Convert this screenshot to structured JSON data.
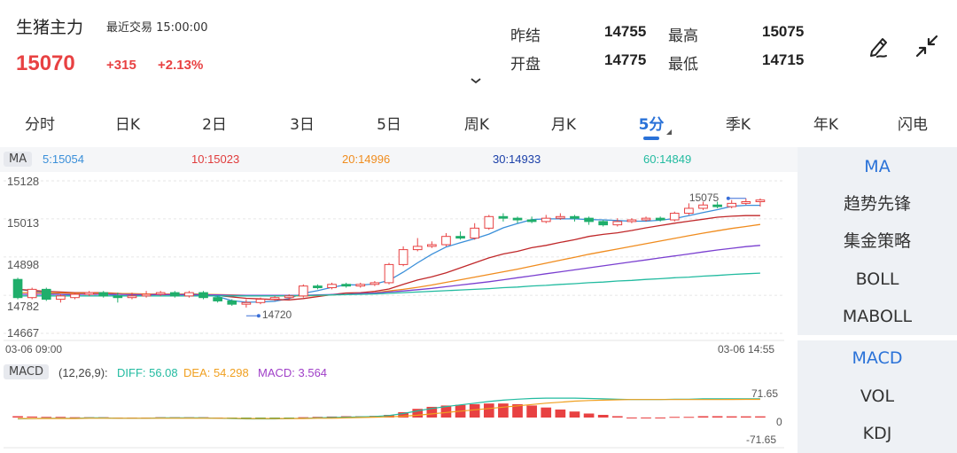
{
  "header": {
    "name": "生猪主力",
    "trade_time": "最近交易 15:00:00",
    "price": "15070",
    "change": "+315",
    "change_pct": "+2.13%",
    "quotes": [
      {
        "label": "昨结",
        "value": "14755"
      },
      {
        "label": "最高",
        "value": "15075"
      },
      {
        "label": "开盘",
        "value": "14775"
      },
      {
        "label": "最低",
        "value": "14715"
      }
    ]
  },
  "tabs": [
    "分时",
    "日K",
    "2日",
    "3日",
    "5日",
    "周K",
    "月K",
    "5分",
    "季K",
    "年K",
    "闪电"
  ],
  "active_tab": "5分",
  "indicators": {
    "main": [
      "MA",
      "趋势先锋",
      "集金策略",
      "BOLL",
      "MABOLL"
    ],
    "sub": [
      "MACD",
      "VOL",
      "KDJ"
    ],
    "active_main": "MA",
    "active_sub": "MACD"
  },
  "ma_legend": {
    "badge": "MA",
    "items": [
      {
        "label": "5:15054",
        "color": "#3a8fd9"
      },
      {
        "label": "10:15023",
        "color": "#e03c3c"
      },
      {
        "label": "20:14996",
        "color": "#f08c1e"
      },
      {
        "label": "30:14933",
        "color": "#1a3fa8"
      },
      {
        "label": "60:14849",
        "color": "#22bba0"
      }
    ]
  },
  "macd_legend": {
    "badge": "MACD",
    "params": "(12,26,9):",
    "diff": "DIFF: 56.08",
    "dea": "DEA: 54.298",
    "macd": "MACD: 3.564",
    "diff_color": "#22bba0",
    "dea_color": "#f0a020",
    "macd_color": "#a040c8"
  },
  "colors": {
    "up": "#e84142",
    "down": "#1fae6b",
    "accent": "#2a72d8"
  },
  "chart_data": {
    "type": "candlestick",
    "y_ticks": [
      "15128",
      "15013",
      "14898",
      "14782",
      "14667"
    ],
    "y_tick_values": [
      15128,
      15013,
      14898,
      14782,
      14667
    ],
    "ylim": [
      14667,
      15128
    ],
    "x_labels": [
      "03-06 09:00",
      "03-06 14:55"
    ],
    "high_label": "15075",
    "low_label": "14720",
    "high_value": 15075,
    "low_value": 14720,
    "candles": [
      [
        14830,
        14775,
        14835,
        14770
      ],
      [
        14775,
        14800,
        14805,
        14770
      ],
      [
        14800,
        14770,
        14805,
        14765
      ],
      [
        14770,
        14780,
        14785,
        14760
      ],
      [
        14775,
        14785,
        14790,
        14770
      ],
      [
        14785,
        14790,
        14795,
        14780
      ],
      [
        14790,
        14780,
        14795,
        14775
      ],
      [
        14780,
        14775,
        14790,
        14760
      ],
      [
        14775,
        14780,
        14790,
        14770
      ],
      [
        14780,
        14785,
        14795,
        14775
      ],
      [
        14785,
        14790,
        14795,
        14780
      ],
      [
        14790,
        14780,
        14795,
        14775
      ],
      [
        14780,
        14790,
        14795,
        14775
      ],
      [
        14790,
        14775,
        14795,
        14770
      ],
      [
        14775,
        14765,
        14780,
        14760
      ],
      [
        14765,
        14755,
        14770,
        14750
      ],
      [
        14755,
        14760,
        14770,
        14745
      ],
      [
        14760,
        14770,
        14775,
        14755
      ],
      [
        14770,
        14775,
        14780,
        14765
      ],
      [
        14775,
        14780,
        14785,
        14770
      ],
      [
        14780,
        14810,
        14815,
        14775
      ],
      [
        14810,
        14805,
        14815,
        14800
      ],
      [
        14805,
        14815,
        14820,
        14800
      ],
      [
        14815,
        14810,
        14820,
        14805
      ],
      [
        14810,
        14815,
        14820,
        14805
      ],
      [
        14815,
        14820,
        14825,
        14810
      ],
      [
        14820,
        14875,
        14880,
        14815
      ],
      [
        14875,
        14920,
        14930,
        14870
      ],
      [
        14920,
        14930,
        14955,
        14915
      ],
      [
        14930,
        14935,
        14945,
        14925
      ],
      [
        14935,
        14960,
        14970,
        14930
      ],
      [
        14960,
        14955,
        14975,
        14950
      ],
      [
        14955,
        14985,
        15000,
        14950
      ],
      [
        14985,
        15020,
        15025,
        14980
      ],
      [
        15020,
        15015,
        15030,
        15005
      ],
      [
        15015,
        15010,
        15020,
        15000
      ],
      [
        15010,
        15005,
        15020,
        15000
      ],
      [
        15005,
        15015,
        15025,
        15000
      ],
      [
        15015,
        15020,
        15030,
        15010
      ],
      [
        15020,
        15015,
        15025,
        15005
      ],
      [
        15015,
        15005,
        15020,
        14995
      ],
      [
        15005,
        14995,
        15010,
        14990
      ],
      [
        14995,
        15005,
        15015,
        14990
      ],
      [
        15005,
        15010,
        15015,
        15000
      ],
      [
        15010,
        15015,
        15020,
        15005
      ],
      [
        15015,
        15010,
        15020,
        15005
      ],
      [
        15010,
        15030,
        15035,
        15005
      ],
      [
        15030,
        15045,
        15060,
        15025
      ],
      [
        15045,
        15055,
        15065,
        15040
      ],
      [
        15055,
        15050,
        15065,
        15045
      ],
      [
        15050,
        15060,
        15070,
        15045
      ],
      [
        15060,
        15065,
        15075,
        15055
      ],
      [
        15065,
        15070,
        15075,
        15050
      ]
    ],
    "ma": {
      "5": [
        14800,
        14795,
        14790,
        14785,
        14782,
        14790,
        14787,
        14781,
        14780,
        14782,
        14786,
        14784,
        14787,
        14785,
        14778,
        14766,
        14761,
        14762,
        14764,
        14772,
        14788,
        14796,
        14806,
        14814,
        14813,
        14816,
        14827,
        14852,
        14880,
        14906,
        14928,
        14941,
        14953,
        14967,
        14986,
        14999,
        15011,
        15013,
        15013,
        15013,
        15011,
        15010,
        15008,
        15006,
        15006,
        15009,
        15014,
        15023,
        15032,
        15041,
        15051,
        15054,
        15054
      ],
      "10": [
        14800,
        14797,
        14794,
        14792,
        14790,
        14790,
        14790,
        14788,
        14786,
        14785,
        14784,
        14784,
        14784,
        14783,
        14781,
        14777,
        14773,
        14771,
        14769,
        14768,
        14772,
        14778,
        14784,
        14789,
        14790,
        14794,
        14801,
        14815,
        14828,
        14838,
        14850,
        14865,
        14880,
        14895,
        14907,
        14915,
        14926,
        14933,
        14942,
        14950,
        14960,
        14966,
        14971,
        14978,
        14986,
        14993,
        15000,
        15006,
        15012,
        15018,
        15021,
        15023,
        15023
      ],
      "20": [
        14790,
        14790,
        14789,
        14789,
        14788,
        14788,
        14788,
        14787,
        14787,
        14786,
        14786,
        14786,
        14785,
        14785,
        14784,
        14783,
        14782,
        14781,
        14780,
        14780,
        14780,
        14781,
        14783,
        14785,
        14787,
        14790,
        14795,
        14800,
        14806,
        14813,
        14821,
        14829,
        14837,
        14845,
        14853,
        14861,
        14870,
        14879,
        14888,
        14897,
        14906,
        14914,
        14922,
        14930,
        14938,
        14946,
        14954,
        14962,
        14970,
        14977,
        14984,
        14990,
        14996
      ],
      "30": [
        14785,
        14785,
        14785,
        14785,
        14785,
        14785,
        14785,
        14785,
        14784,
        14784,
        14784,
        14784,
        14783,
        14783,
        14783,
        14782,
        14782,
        14782,
        14782,
        14782,
        14782,
        14783,
        14784,
        14785,
        14787,
        14789,
        14792,
        14795,
        14799,
        14803,
        14808,
        14813,
        14818,
        14823,
        14829,
        14835,
        14841,
        14847,
        14853,
        14859,
        14865,
        14871,
        14877,
        14883,
        14889,
        14895,
        14901,
        14907,
        14913,
        14919,
        14924,
        14929,
        14933
      ],
      "60": [
        14780,
        14780,
        14780,
        14780,
        14780,
        14780,
        14780,
        14780,
        14780,
        14780,
        14780,
        14780,
        14780,
        14780,
        14780,
        14780,
        14780,
        14780,
        14780,
        14781,
        14781,
        14782,
        14783,
        14784,
        14785,
        14786,
        14788,
        14790,
        14792,
        14794,
        14796,
        14798,
        14800,
        14802,
        14805,
        14807,
        14810,
        14812,
        14815,
        14817,
        14820,
        14822,
        14825,
        14827,
        14830,
        14832,
        14835,
        14837,
        14840,
        14842,
        14845,
        14847,
        14849
      ]
    },
    "macd": {
      "ticks": [
        "71.65",
        "0",
        "-71.65"
      ],
      "tick_values": [
        71.65,
        0,
        -71.65
      ],
      "ylim": [
        -71.65,
        71.65
      ],
      "diff": [
        -4,
        -3,
        -2,
        -2,
        -2,
        -1,
        -1,
        -2,
        -2,
        -2,
        -1,
        -1,
        -1,
        -1,
        -2,
        -3,
        -4,
        -4,
        -4,
        -3,
        -2,
        -1,
        0,
        1,
        2,
        3,
        6,
        12,
        20,
        27,
        33,
        38,
        43,
        48,
        52,
        55,
        57,
        58,
        58,
        58,
        57,
        56,
        55,
        54,
        54,
        54,
        55,
        55,
        56,
        56,
        56,
        56,
        56.08
      ],
      "dea": [
        -3,
        -3,
        -3,
        -3,
        -3,
        -2,
        -2,
        -2,
        -2,
        -2,
        -2,
        -2,
        -2,
        -2,
        -2,
        -2,
        -3,
        -3,
        -3,
        -3,
        -3,
        -2,
        -2,
        -1,
        0,
        1,
        2,
        4,
        7,
        11,
        15,
        19,
        23,
        27,
        31,
        35,
        39,
        43,
        46,
        49,
        51,
        52,
        53,
        54,
        54,
        54,
        54,
        54,
        54,
        54,
        54.2,
        54.29,
        54.298
      ],
      "hist": [
        4,
        3,
        2,
        2,
        1,
        1,
        1,
        0,
        0,
        0,
        1,
        1,
        1,
        1,
        0,
        -1,
        -2,
        -2,
        -2,
        -1,
        1,
        2,
        3,
        4,
        4,
        5,
        8,
        16,
        26,
        32,
        36,
        38,
        40,
        42,
        42,
        40,
        36,
        30,
        24,
        18,
        12,
        8,
        4,
        0,
        0,
        0,
        2,
        2,
        4,
        4,
        3.6,
        3.56,
        3.564
      ]
    }
  }
}
